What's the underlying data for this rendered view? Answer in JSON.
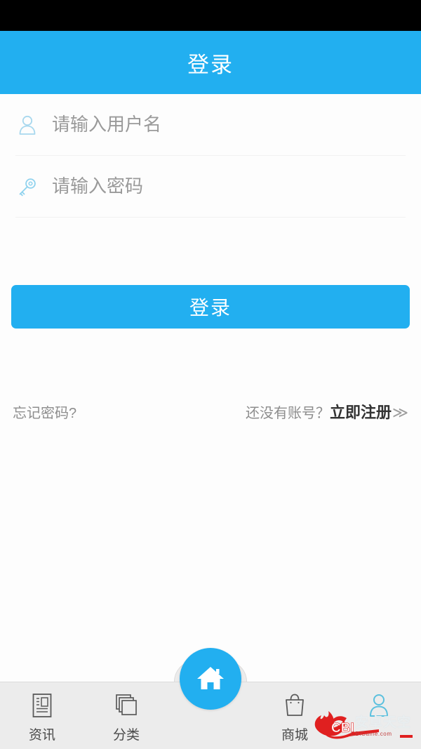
{
  "header": {
    "title": "登录"
  },
  "form": {
    "username": {
      "placeholder": "请输入用户名",
      "value": "",
      "icon": "user-icon"
    },
    "password": {
      "placeholder": "请输入密码",
      "value": "",
      "icon": "key-icon"
    }
  },
  "actions": {
    "login_label": "登录"
  },
  "links": {
    "forgot_password": "忘记密码?",
    "register_prefix": "还没有账号？",
    "register_action": "立即注册",
    "register_chevron": "≫"
  },
  "tabbar": {
    "items": [
      {
        "label": "资讯",
        "icon": "news-icon",
        "active": false
      },
      {
        "label": "分类",
        "icon": "categories-icon",
        "active": false
      },
      {
        "label": "",
        "icon": "home-icon",
        "active": true
      },
      {
        "label": "商城",
        "icon": "shopping-bag-icon",
        "active": false
      },
      {
        "label": "",
        "icon": "profile-person-icon",
        "active": false
      }
    ]
  },
  "watermark": {
    "brand": "CBI",
    "cn_text": "安卓天空",
    "site": "CBiGame.com"
  },
  "colors": {
    "accent": "#22aff0",
    "statusbar": "#000000",
    "tabbar_bg": "#ececec",
    "placeholder": "#9a9a9a",
    "link_gray": "#8d8d8d",
    "watermark_red": "#e02020"
  }
}
